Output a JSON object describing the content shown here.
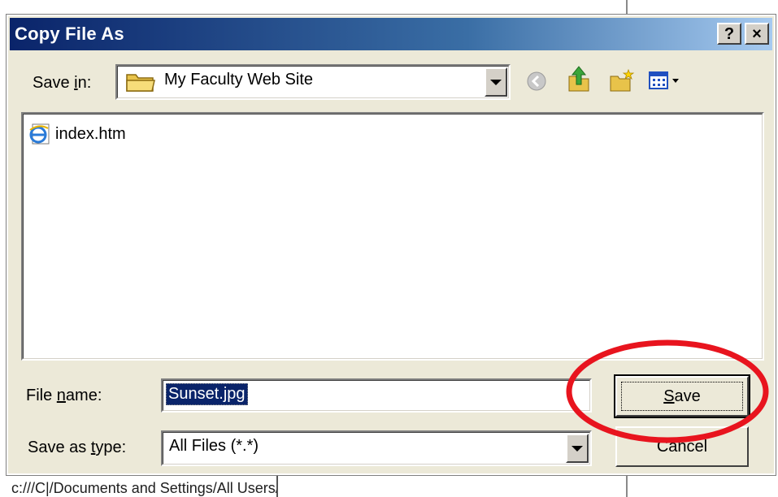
{
  "dialog": {
    "title": "Copy File As",
    "help_button": "?",
    "close_button": "×"
  },
  "save_in": {
    "label_pre": "Save ",
    "label_mnemonic": "i",
    "label_post": "n:",
    "value": "My Faculty Web Site"
  },
  "toolbar": {
    "icons": [
      "back-icon",
      "up-folder-icon",
      "new-folder-icon",
      "view-menu-icon"
    ]
  },
  "file_list": {
    "items": [
      {
        "name": "index.htm",
        "icon": "ie-document-icon"
      }
    ]
  },
  "file_name": {
    "label_pre": "File ",
    "label_mnemonic": "n",
    "label_post": "ame:",
    "value": "Sunset.jpg"
  },
  "save_as_type": {
    "label_pre": "Save as ",
    "label_mnemonic": "t",
    "label_post": "ype:",
    "value": "All Files (*.*)"
  },
  "buttons": {
    "save_mnemonic": "S",
    "save_rest": "ave",
    "cancel": "Cancel"
  },
  "background": {
    "path_text": "c:///C|/Documents and Settings/All Users/Do"
  },
  "colors": {
    "title_gradient_start": "#0a246a",
    "dialog_face": "#ece9d8",
    "highlight_ring": "#e8141e",
    "selection": "#0a246a"
  }
}
